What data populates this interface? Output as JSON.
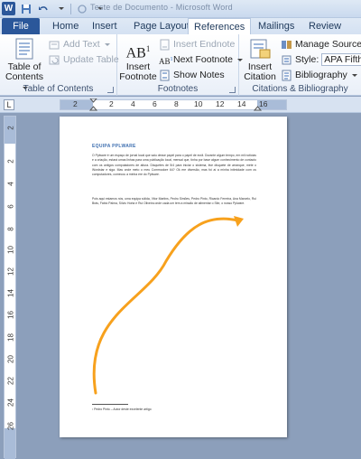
{
  "window": {
    "title": "Teste de Documento - Microsoft Word"
  },
  "tabs": [
    {
      "label": "File"
    },
    {
      "label": "Home"
    },
    {
      "label": "Insert"
    },
    {
      "label": "Page Layout"
    },
    {
      "label": "References"
    },
    {
      "label": "Mailings"
    },
    {
      "label": "Review"
    }
  ],
  "ribbon": {
    "toc": {
      "table_of_contents": "Table of\nContents",
      "add_text": "Add Text",
      "update_table": "Update Table",
      "group_label": "Table of Contents"
    },
    "footnotes": {
      "insert_footnote": "Insert\nFootnote",
      "icon_text": "AB",
      "icon_sup": "1",
      "insert_endnote": "Insert Endnote",
      "next_footnote": "Next Footnote",
      "show_notes": "Show Notes",
      "group_label": "Footnotes"
    },
    "citations": {
      "insert_citation": "Insert\nCitation",
      "manage_sources": "Manage Sources",
      "style_label": "Style:",
      "style_value": "APA Fifth",
      "bibliography": "Bibliography",
      "group_label": "Citations & Bibliography"
    }
  },
  "ruler": {
    "tab_selector": "L",
    "horizontal_numbers": [
      "2",
      "2",
      "4",
      "6",
      "8",
      "10",
      "12",
      "14",
      "16"
    ],
    "vertical_numbers": [
      "2",
      "2",
      "4",
      "6",
      "8",
      "10",
      "12",
      "14",
      "16",
      "18",
      "20",
      "22",
      "24",
      "26"
    ]
  },
  "document": {
    "heading": "EQUIPA PPLWARE",
    "paragraph1": "O Pplware é um espaço de jornal local que saiu desse papel para o papel de ecrã. Durante algum tempo, em mil noticias e a criação, estará umas linhas para uma publicação local, mensal que, tinha por base algum conhecimento de contacto com os antigos computadores de altura. Disquetes de 5/4 para iniciar o sistema, tive disquete de arranque, mete o Wordstar e siga. Mas onde meto o meu Commodore 64? Ok ere diversão, mas foi aí a minha intimidade com os computadores, comecou a minha ere do Pplware.",
    "paragraph2": "Pois aqui estamos nós, uma equipa sólida, Vitor Martins, Pedro Simões, Pedro Pinto, Ricardo Ferreira, Ana Marcelo, Rui Brás, Fábio Palma, Sílvio Horta e Rui Oliveira onde cada um tem a missão de alimentar o Site, o nosso Pplware.",
    "footnote": "¹ Pedro Pinto – Autor deste excelente artigo"
  },
  "colors": {
    "file_tab": "#2b579a",
    "accent": "#3e6fb0",
    "arrow": "#f7a11d",
    "background": "#8c9fbb"
  }
}
